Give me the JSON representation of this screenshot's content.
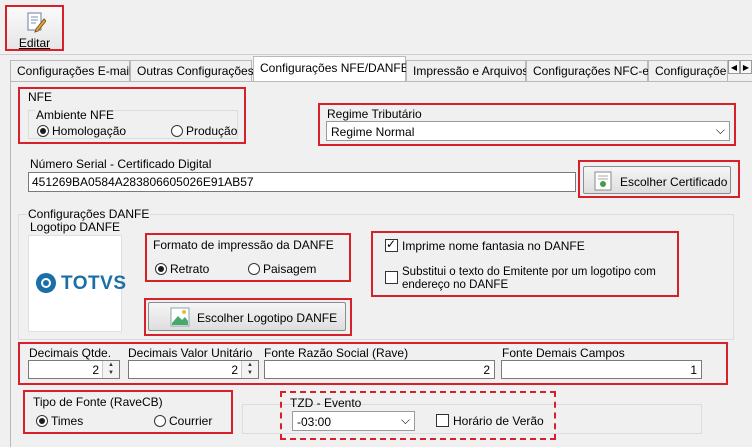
{
  "toolbar": {
    "edit_label": "Editar"
  },
  "tabs": [
    {
      "label": "Configurações E-mail"
    },
    {
      "label": "Outras Configurações"
    },
    {
      "label": "Configurações NFE/DANFE"
    },
    {
      "label": "Impressão e Arquivos"
    },
    {
      "label": "Configurações NFC-e"
    },
    {
      "label": "Configuraçõe"
    }
  ],
  "nfe": {
    "group_title": "NFE",
    "ambiente_title": "Ambiente NFE",
    "ambiente_options": [
      "Homologação",
      "Produção"
    ],
    "ambiente_selected": "Homologação"
  },
  "regime": {
    "title": "Regime Tributário",
    "value": "Regime Normal"
  },
  "serial": {
    "label": "Número Serial - Certificado Digital",
    "value": "451269BA0584A283806605026E91AB57"
  },
  "cert_button": "Escolher Certificado",
  "danfe": {
    "group_title": "Configurações DANFE",
    "logo_title": "Logotipo DANFE",
    "logo_text": "TOTVS",
    "format_title": "Formato de impressão da DANFE",
    "format_options": [
      "Retrato",
      "Paisagem"
    ],
    "format_selected": "Retrato",
    "logo_button": "Escolher Logotipo DANFE",
    "check_fantasia": "Imprime nome fantasia no DANFE",
    "check_fantasia_on": true,
    "check_logo_line1": "Substitui o texto do Emitente por um logotipo com",
    "check_logo_line2": "endereço no DANFE",
    "check_logo_on": false
  },
  "fields": {
    "decimais_qtde_label": "Decimais Qtde.",
    "decimais_qtde": "2",
    "decimais_valor_label": "Decimais Valor Unitário",
    "decimais_valor": "2",
    "fonte_razao_label": "Fonte Razão Social (Rave)",
    "fonte_razao": "2",
    "fonte_demais_label": "Fonte Demais Campos",
    "fonte_demais": "1"
  },
  "tipo_fonte": {
    "title": "Tipo de Fonte (RaveCB)",
    "options": [
      "Times",
      "Courrier"
    ],
    "selected": "Times"
  },
  "tzd": {
    "title": "TZD - Evento",
    "value": "-03:00",
    "horario_verao": "Horário de Verão",
    "horario_verao_on": false
  }
}
